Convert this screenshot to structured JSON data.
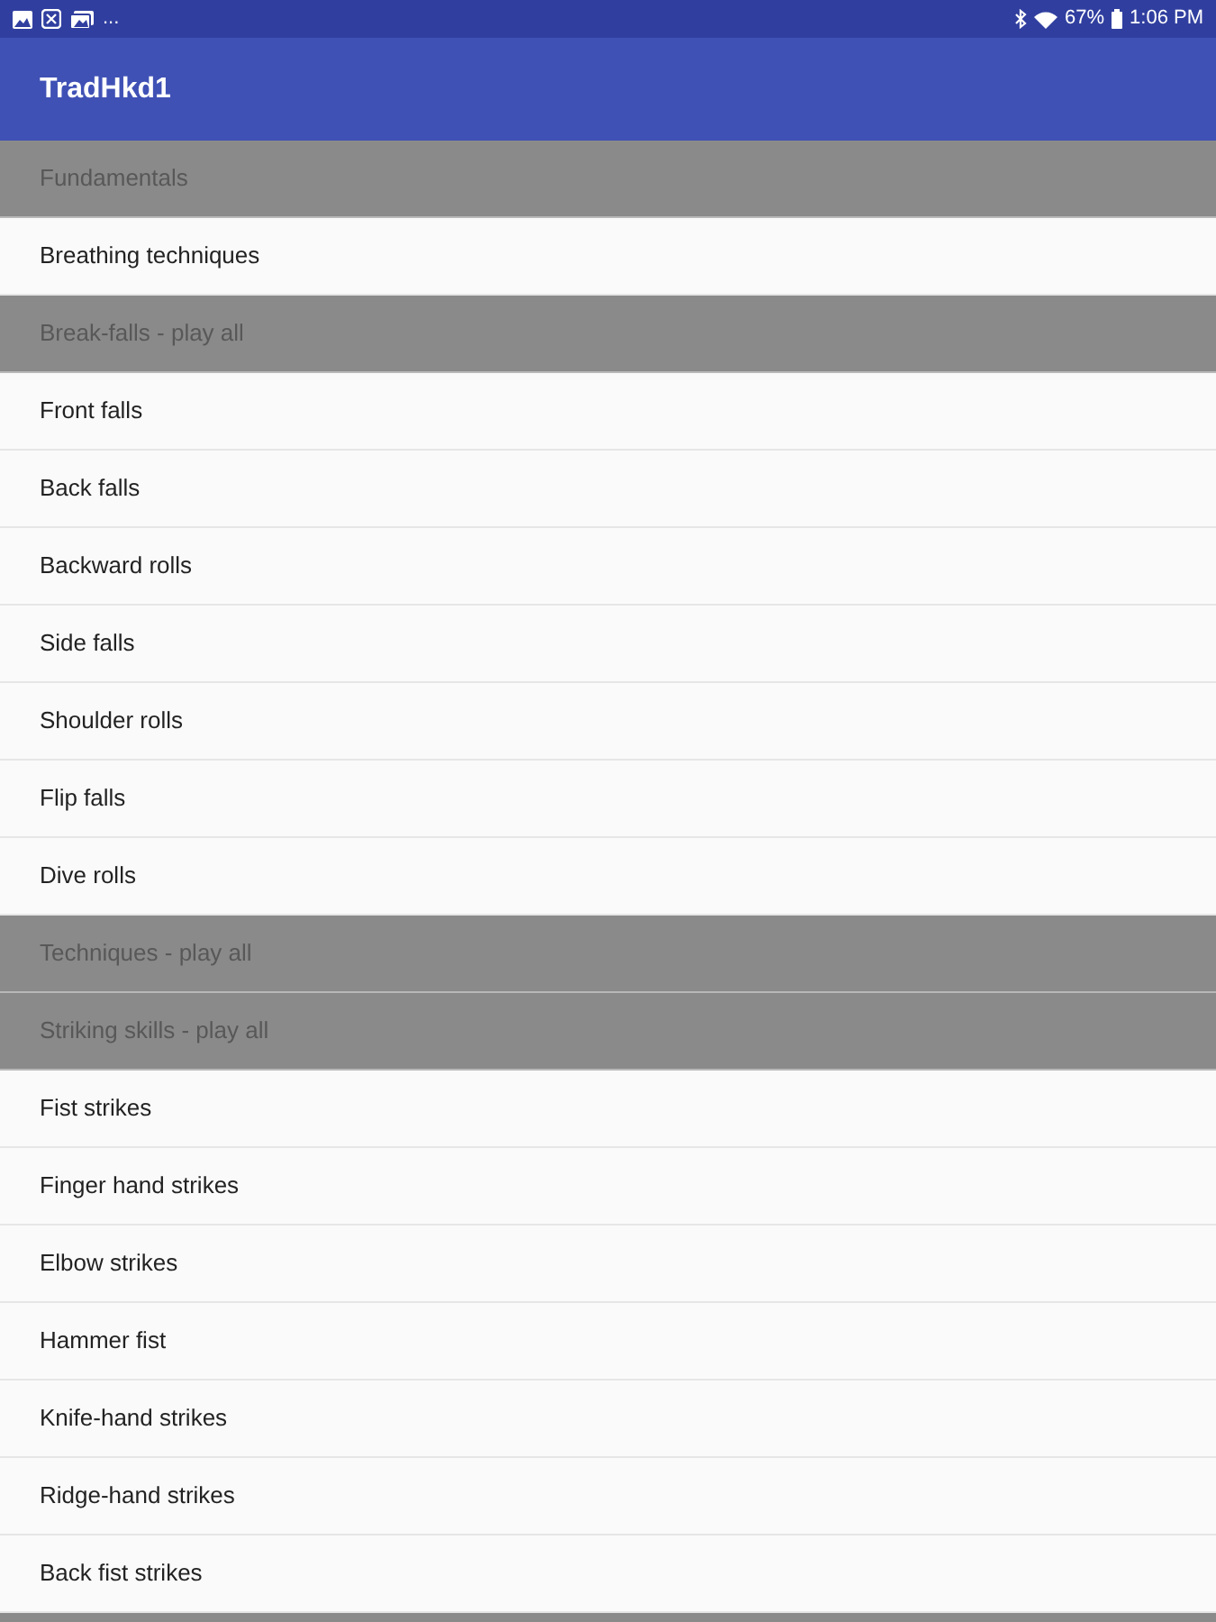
{
  "status_bar": {
    "overflow": "...",
    "battery_percent": "67%",
    "time": "1:06 PM"
  },
  "app_bar": {
    "title": "TradHkd1"
  },
  "list": [
    {
      "kind": "header",
      "label": "Fundamentals"
    },
    {
      "kind": "item",
      "label": "Breathing techniques"
    },
    {
      "kind": "header",
      "label": "Break-falls - play all"
    },
    {
      "kind": "item",
      "label": "Front falls"
    },
    {
      "kind": "item",
      "label": "Back falls"
    },
    {
      "kind": "item",
      "label": "Backward rolls"
    },
    {
      "kind": "item",
      "label": "Side falls"
    },
    {
      "kind": "item",
      "label": "Shoulder rolls"
    },
    {
      "kind": "item",
      "label": "Flip falls"
    },
    {
      "kind": "item",
      "label": "Dive rolls"
    },
    {
      "kind": "header",
      "label": "Techniques - play all"
    },
    {
      "kind": "header",
      "label": "Striking skills - play all"
    },
    {
      "kind": "item",
      "label": "Fist strikes"
    },
    {
      "kind": "item",
      "label": "Finger hand strikes"
    },
    {
      "kind": "item",
      "label": "Elbow strikes"
    },
    {
      "kind": "item",
      "label": "Hammer fist"
    },
    {
      "kind": "item",
      "label": "Knife-hand strikes"
    },
    {
      "kind": "item",
      "label": "Ridge-hand strikes"
    },
    {
      "kind": "item",
      "label": "Back fist strikes"
    },
    {
      "kind": "header_edge"
    }
  ]
}
